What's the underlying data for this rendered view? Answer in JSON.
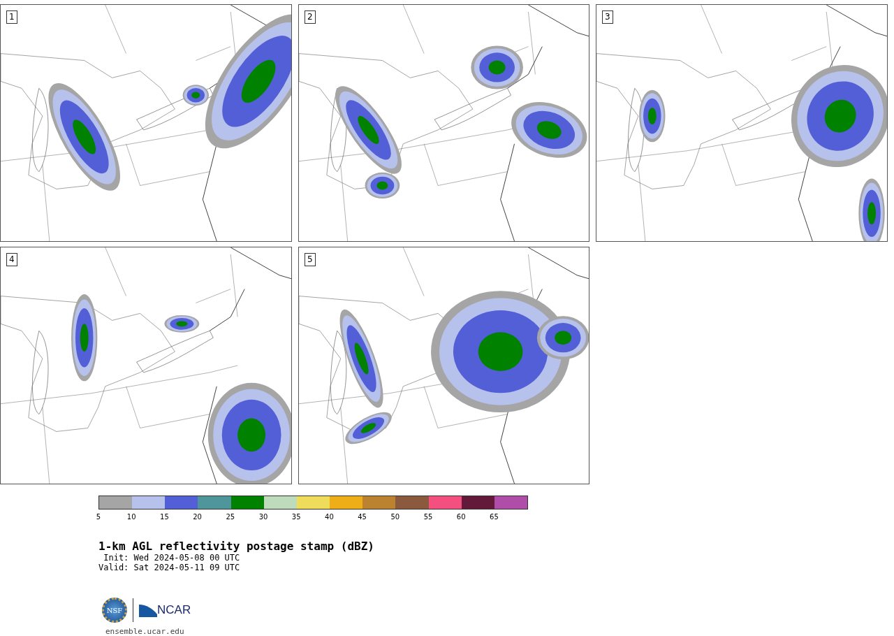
{
  "panels": [
    {
      "label": "1"
    },
    {
      "label": "2"
    },
    {
      "label": "3"
    },
    {
      "label": "4"
    },
    {
      "label": "5"
    }
  ],
  "colorbar": {
    "segments": [
      {
        "color": "#a5a5a5"
      },
      {
        "color": "#b7c2ec"
      },
      {
        "color": "#535fd6"
      },
      {
        "color": "#4e969c"
      },
      {
        "color": "#008200"
      },
      {
        "color": "#bedcbc"
      },
      {
        "color": "#efdc5a"
      },
      {
        "color": "#eeae18"
      },
      {
        "color": "#bb8230"
      },
      {
        "color": "#8b5a3e"
      },
      {
        "color": "#f4507f"
      },
      {
        "color": "#62193a"
      },
      {
        "color": "#b04da9"
      }
    ],
    "ticks": [
      "5",
      "10",
      "15",
      "20",
      "25",
      "30",
      "35",
      "40",
      "45",
      "50",
      "55",
      "60",
      "65"
    ]
  },
  "title": "1-km AGL reflectivity postage stamp (dBZ)",
  "init": " Init: Wed 2024-05-08 00 UTC",
  "valid": "Valid: Sat 2024-05-11 09 UTC",
  "logo": {
    "nsf": "NSF",
    "ncar": "NCAR"
  },
  "footer": "ensemble.ucar.edu"
}
